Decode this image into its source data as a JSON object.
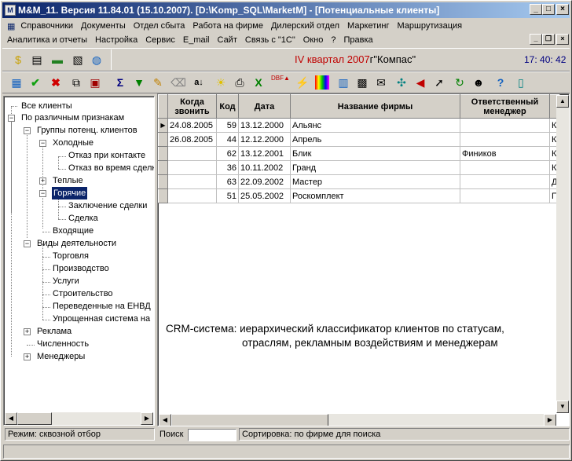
{
  "title": "M&M_11. Версия 11.84.01 (15.10.2007).  [D:\\Komp_SQL\\MarketM] - [Потенциальные клиенты]",
  "menu1": [
    "Справочники",
    "Документы",
    "Отдел сбыта",
    "Работа на фирме",
    "Дилерский отдел",
    "Маркетинг",
    "Маршрутизация"
  ],
  "menu2": [
    "Аналитика и отчеты",
    "Настройка",
    "Сервис",
    "E_mail",
    "Сайт",
    "Связь с \"1С\"",
    "Окно",
    "?",
    "Правка"
  ],
  "period": "IV квартал 2007",
  "company": "г\"Компас\"",
  "clock": "17: 40: 42",
  "tree": [
    "Все клиенты",
    "По различным признакам",
    "Группы потенц. клиентов",
    "Холодные",
    "Отказ при контакте",
    "Отказ во время сделки",
    "Теплые",
    "Горячие",
    "Заключение сделки",
    "Сделка",
    "Входящие",
    "Виды деятельности",
    "Торговля",
    "Производство",
    "Услуги",
    "Строительство",
    "Переведенные на ЕНВД",
    "Упрощенная система на",
    "Реклама",
    "Численность",
    "Менеджеры"
  ],
  "grid": {
    "headers": [
      "Когда звонить",
      "Код",
      "Дата",
      "Название фирмы",
      "Ответственный менеджер"
    ],
    "rows": [
      {
        "when": "24.08.2005",
        "code": "59",
        "date": "13.12.2000",
        "name": "Альянс",
        "manager": "",
        "extra": "К"
      },
      {
        "when": "26.08.2005",
        "code": "44",
        "date": "12.12.2000",
        "name": "Апрель",
        "manager": "",
        "extra": "К"
      },
      {
        "when": "",
        "code": "62",
        "date": "13.12.2001",
        "name": "Блик",
        "manager": "Фиников",
        "extra": "К"
      },
      {
        "when": "",
        "code": "36",
        "date": "10.11.2002",
        "name": "Гранд",
        "manager": "",
        "extra": "К"
      },
      {
        "when": "",
        "code": "63",
        "date": "22.09.2002",
        "name": "Мастер",
        "manager": "",
        "extra": "Д"
      },
      {
        "when": "",
        "code": "51",
        "date": "25.05.2002",
        "name": "Роскомплект",
        "manager": "",
        "extra": "П"
      }
    ]
  },
  "caption_line1": "CRM-система:  иерархический классификатор клиентов по статусам,",
  "caption_line2": "отраслям, рекламным воздействиям и менеджерам",
  "status_mode": "Режим: сквозной отбор",
  "search_label": "Поиск",
  "search_value": "",
  "sort_label": "Сортировка: по фирме для поиска",
  "colors": {
    "title_start": "#0a246a",
    "title_end": "#a6caf0",
    "period": "#c00000",
    "selection": "#0a246a"
  }
}
